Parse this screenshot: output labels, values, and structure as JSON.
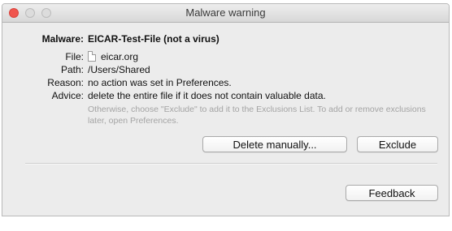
{
  "window": {
    "title": "Malware warning"
  },
  "details": {
    "malware_label": "Malware:",
    "malware_value": "EICAR-Test-File (not a virus)",
    "file_label": "File:",
    "file_value": "eicar.org",
    "path_label": "Path:",
    "path_value": "/Users/Shared",
    "reason_label": "Reason:",
    "reason_value": "no action was set in Preferences.",
    "advice_label": "Advice:",
    "advice_value": "delete the entire file if it does not contain valuable data.",
    "hint": "Otherwise, choose \"Exclude\" to add it to the Exclusions List. To add or remove exclusions later, open Preferences."
  },
  "buttons": {
    "delete_label": "Delete manually...",
    "exclude_label": "Exclude",
    "feedback_label": "Feedback"
  },
  "icons": {
    "file": "document-icon"
  }
}
